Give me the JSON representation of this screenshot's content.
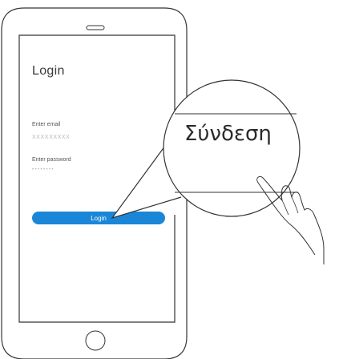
{
  "login_screen": {
    "title": "Login",
    "email_label": "Enter email",
    "email_value": "XXXXXXXXX",
    "password_label": "Enter password",
    "password_value": "••••••••",
    "login_button_label": "Login"
  },
  "zoom": {
    "translated_label": "Σύνδεση"
  },
  "colors": {
    "button": "#1a86d8",
    "outline": "#333333"
  }
}
